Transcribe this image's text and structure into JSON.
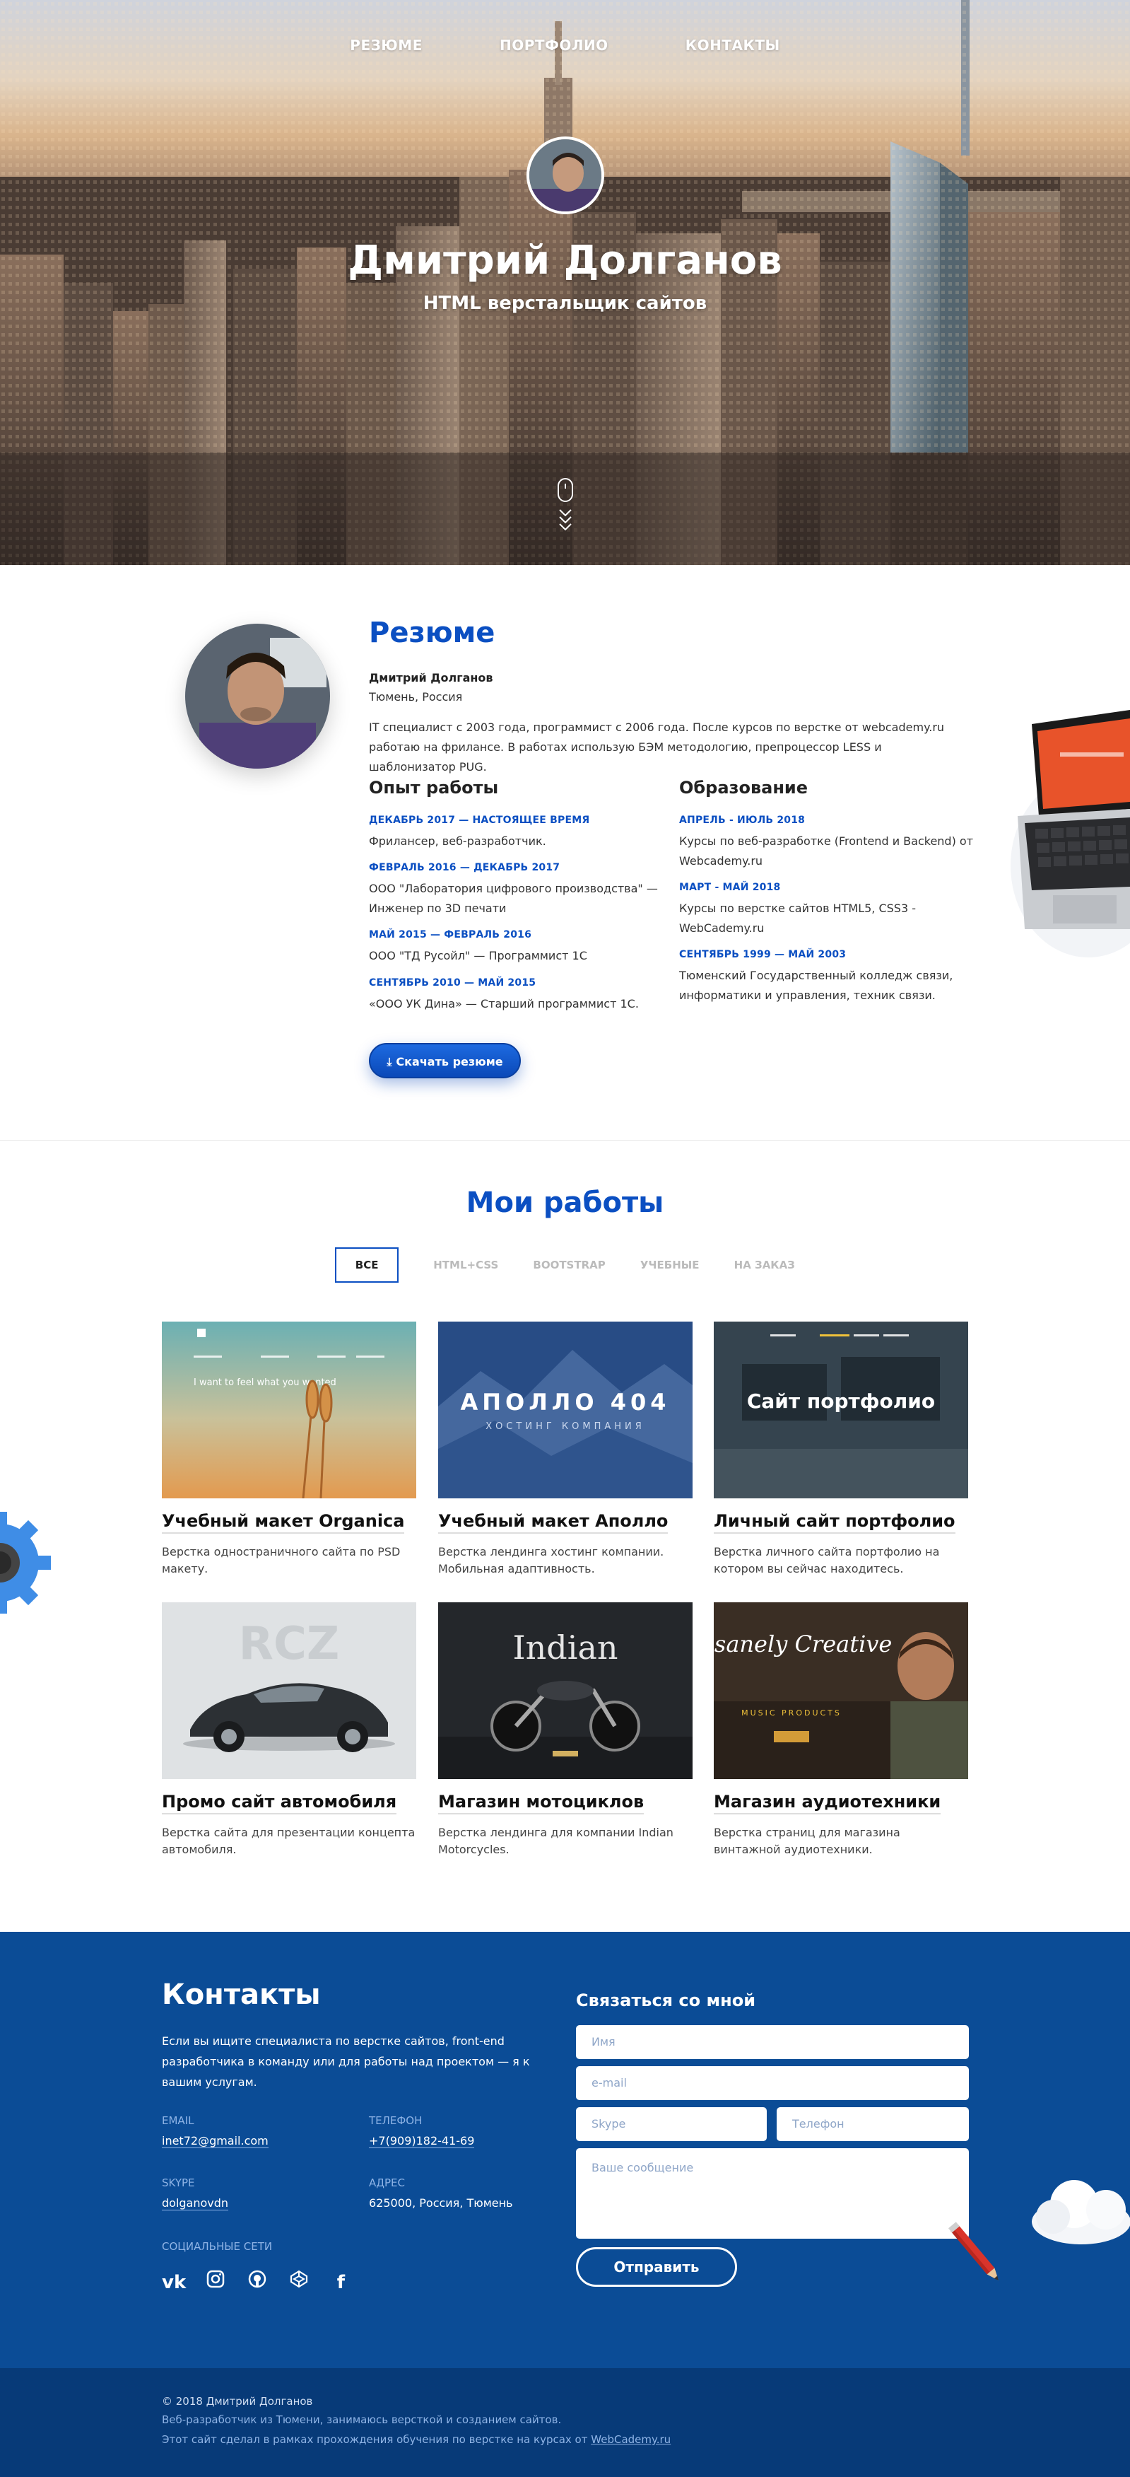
{
  "nav": {
    "items": [
      "РЕЗЮМЕ",
      "ПОРТФОЛИО",
      "КОНТАКТЫ"
    ]
  },
  "hero": {
    "name": "Дмитрий Долганов",
    "subtitle": "HTML верстальщик сайтов"
  },
  "resume": {
    "title": "Резюме",
    "name": "Дмитрий Долганов",
    "city": "Тюмень, Россия",
    "about": "IT специалист с 2003 года, программист с 2006 года. После курсов по верстке от webcademy.ru работаю на фрилансе. В работах использую БЭМ методологию, препроцессор LESS и шаблонизатор PUG.",
    "experience_title": "Опыт работы",
    "experience": [
      {
        "date": "ДЕКАБРЬ 2017 — НАСТОЯЩЕЕ ВРЕМЯ",
        "text": "Фрилансер, веб-разработчик."
      },
      {
        "date": "ФЕВРАЛЬ 2016 — ДЕКАБРЬ 2017",
        "text": "ООО \"Лаборатория цифрового производства\" — Инженер по 3D печати"
      },
      {
        "date": "МАЙ 2015 — ФЕВРАЛЬ 2016",
        "text": "ООО \"ТД Русойл\" — Программист 1С"
      },
      {
        "date": "СЕНТЯБРЬ 2010 — МАЙ 2015",
        "text": "«ООО УК Дина» — Старший программист 1С."
      }
    ],
    "education_title": "Образование",
    "education": [
      {
        "date": "АПРЕЛЬ - ИЮЛЬ 2018",
        "text": "Курсы по веб-разработке (Frontend и Backend) от Webcademy.ru"
      },
      {
        "date": "МАРТ - МАЙ 2018",
        "text": "Курсы по верстке сайтов HTML5, CSS3 - WebCademy.ru"
      },
      {
        "date": "СЕНТЯБРЬ 1999 — МАЙ 2003",
        "text": "Тюменский Государственный колледж связи, информатики и управления, техник связи."
      }
    ],
    "download_label": "Скачать резюме"
  },
  "works": {
    "title": "Мои работы",
    "filters": [
      "ВСЕ",
      "HTML+CSS",
      "BOOTSTRAP",
      "УЧЕБНЫЕ",
      "НА ЗАКАЗ"
    ],
    "active_filter": "ВСЕ",
    "cards": [
      {
        "title": "Учебный макет Organica",
        "desc": "Верстка одностраничного сайта по PSD макету.",
        "image_text": "I want to feel what you wanted"
      },
      {
        "title": "Учебный макет Аполло",
        "desc": "Верстка лендинга хостинг компании. Мобильная адаптивность.",
        "image_text": "АПОЛЛО 404",
        "image_sub": "ХОСТИНГ КОМПАНИЯ"
      },
      {
        "title": "Личный сайт портфолио",
        "desc": "Верстка личного сайта портфолио на котором вы сейчас находитесь.",
        "image_text": "Сайт портфолио"
      },
      {
        "title": "Промо сайт автомобиля",
        "desc": "Верстка сайта для презентации концепта автомобиля.",
        "image_text": "RCZ"
      },
      {
        "title": "Магазин мотоциклов",
        "desc": "Верстка лендинга для компании Indian Motorcycles.",
        "image_text": "Indian"
      },
      {
        "title": "Магазин аудиотехники",
        "desc": "Верстка страниц для магазина винтажной аудиотехники.",
        "image_text": "Insanely Creative",
        "image_sub": "MUSIC PRODUCTS"
      }
    ]
  },
  "contacts": {
    "title": "Контакты",
    "intro": "Если вы ищите специалиста по верстке сайтов, front-end разработчика в команду или для работы над проектом — я к вашим услугам.",
    "email_label": "EMAIL",
    "email": "inet72@gmail.com",
    "phone_label": "ТЕЛЕФОН",
    "phone": "+7(909)182-41-69",
    "skype_label": "SKYPE",
    "skype": "dolganovdn",
    "address_label": "АДРЕС",
    "address": "625000, Россия, Тюмень",
    "social_label": "СОЦИАЛЬНЫЕ СЕТИ",
    "form": {
      "title": "Связаться со мной",
      "name_placeholder": "Имя",
      "email_placeholder": "e-mail",
      "skype_placeholder": "Skype",
      "phone_placeholder": "Телефон",
      "message_placeholder": "Ваше сообщение",
      "submit_label": "Отправить"
    }
  },
  "footer": {
    "copyright": "© 2018 Дмитрий Долганов",
    "line2": "Веб-разработчик из Тюмени, занимаюсь версткой и созданием сайтов.",
    "line3": "Этот сайт сделал в рамках прохождения обучения по верстке на курсах от",
    "line3_link": "WebCademy.ru"
  },
  "colors": {
    "accent": "#0b4fc2",
    "contacts_bg": "#0b4c96",
    "footer_bg": "#073a78"
  }
}
